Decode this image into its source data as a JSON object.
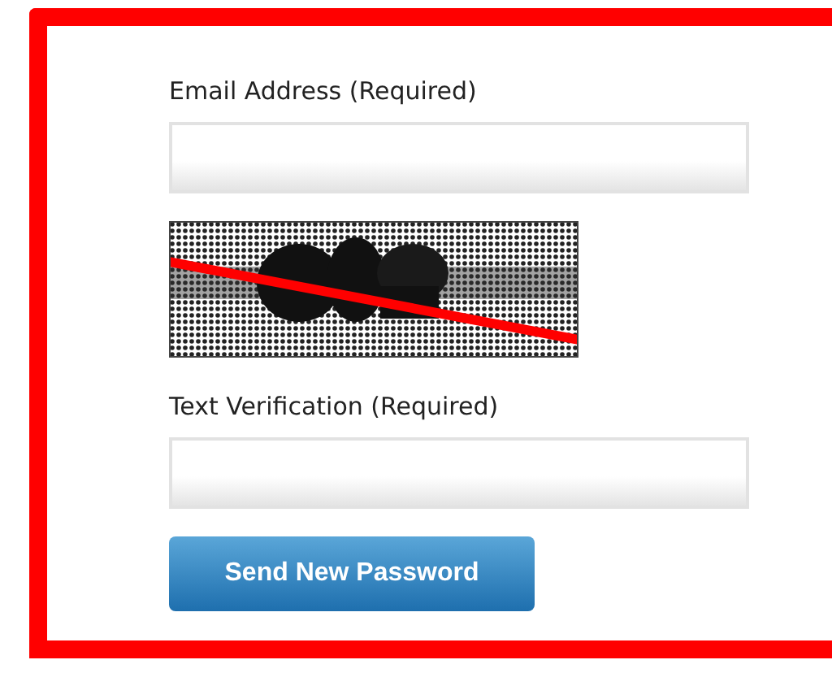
{
  "form": {
    "fields": [
      {
        "kind": "text",
        "label": "Email Address (Required)"
      },
      {
        "kind": "captcha"
      },
      {
        "kind": "text",
        "label": "Text Verification (Required)"
      }
    ],
    "button": "Send New Password"
  }
}
